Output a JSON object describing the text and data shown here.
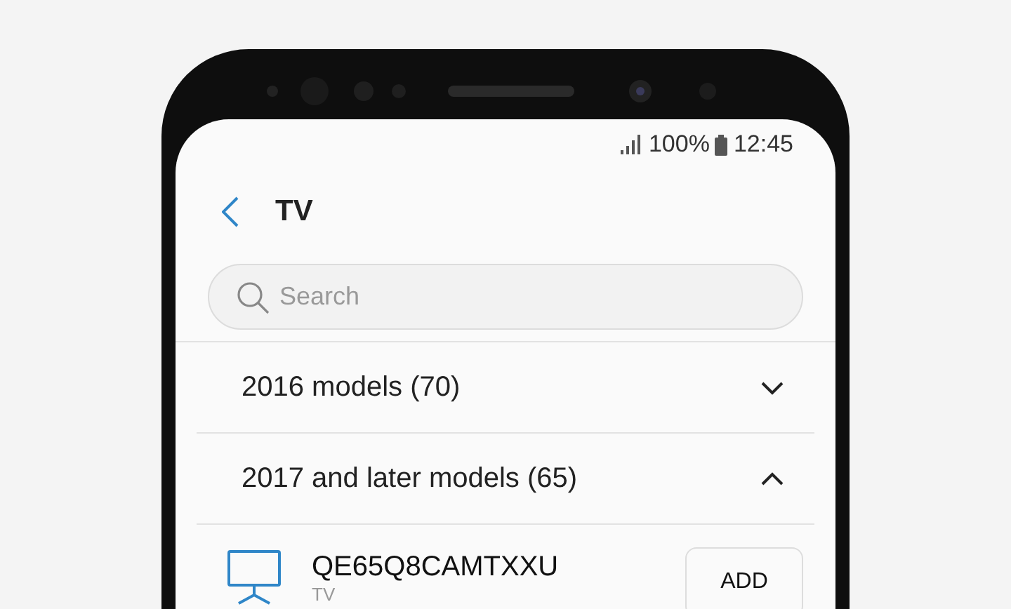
{
  "status_bar": {
    "battery": "100%",
    "time": "12:45"
  },
  "header": {
    "title": "TV"
  },
  "search": {
    "placeholder": "Search"
  },
  "groups": [
    {
      "label": "2016 models (70)",
      "expanded": false
    },
    {
      "label": "2017 and later models (65)",
      "expanded": true,
      "devices": [
        {
          "name": "QE65Q8CAMTXXU",
          "type": "TV",
          "button": "ADD"
        }
      ]
    }
  ]
}
